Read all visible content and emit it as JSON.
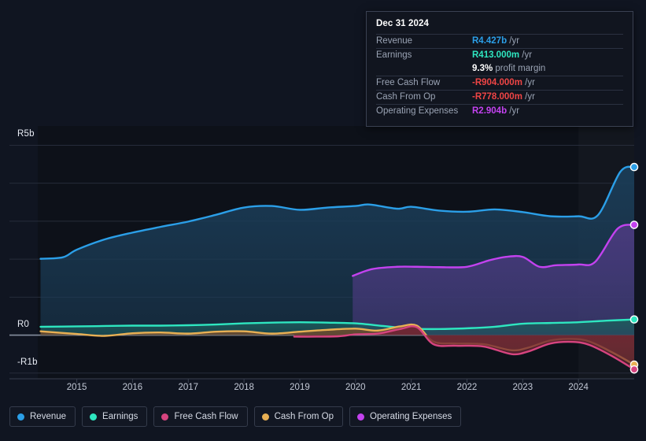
{
  "tooltip": {
    "date": "Dec 31 2024",
    "rows": [
      {
        "key": "Revenue",
        "amount": "R4.427b",
        "unit": "/yr",
        "color": "#2b9fe8"
      },
      {
        "key": "Earnings",
        "amount": "R413.000m",
        "unit": "/yr",
        "color": "#2ee6c0"
      },
      {
        "key": "",
        "amount": "9.3%",
        "unit": "profit margin",
        "color": "#ffffff"
      },
      {
        "key": "Free Cash Flow",
        "amount": "-R904.000m",
        "unit": "/yr",
        "color": "#ef4545"
      },
      {
        "key": "Cash From Op",
        "amount": "-R778.000m",
        "unit": "/yr",
        "color": "#ef4545"
      },
      {
        "key": "Operating Expenses",
        "amount": "R2.904b",
        "unit": "/yr",
        "color": "#c342ef"
      }
    ]
  },
  "legend": [
    {
      "label": "Revenue",
      "color": "#2b9fe8"
    },
    {
      "label": "Earnings",
      "color": "#2ee6c0"
    },
    {
      "label": "Free Cash Flow",
      "color": "#d6447f"
    },
    {
      "label": "Cash From Op",
      "color": "#e8b054"
    },
    {
      "label": "Operating Expenses",
      "color": "#c342ef"
    }
  ],
  "chart_data": {
    "type": "area",
    "title": "",
    "xlabel": "",
    "ylabel": "",
    "currency_prefix": "R",
    "grid": true,
    "legend_position": "bottom",
    "ylim": [
      -1.15,
      5.3
    ],
    "ytick_labels": [
      "R5b",
      "R0",
      "-R1b"
    ],
    "ytick_values": [
      5,
      0,
      -1
    ],
    "xtick_labels": [
      "2015",
      "2016",
      "2017",
      "2018",
      "2019",
      "2020",
      "2021",
      "2022",
      "2023",
      "2024"
    ],
    "xtick_values": [
      2015,
      2016,
      2017,
      2018,
      2019,
      2020,
      2021,
      2022,
      2023,
      2024
    ],
    "xlim": [
      2014.3,
      2025.0
    ],
    "highlight_band": {
      "from": 2024.0,
      "to": 2025.0
    },
    "units": "billions of ZAR per year",
    "series": [
      {
        "name": "Revenue",
        "color": "#2b9fe8",
        "fill": "#1b3d58",
        "x": [
          2014.35,
          2014.75,
          2015.0,
          2015.5,
          2016.0,
          2016.5,
          2017.0,
          2017.5,
          2018.0,
          2018.5,
          2019.0,
          2019.5,
          2020.0,
          2020.25,
          2020.75,
          2021.0,
          2021.5,
          2022.0,
          2022.5,
          2023.0,
          2023.5,
          2024.0,
          2024.35,
          2024.75,
          2025.0
        ],
        "y": [
          2.01,
          2.05,
          2.25,
          2.52,
          2.7,
          2.85,
          2.99,
          3.17,
          3.36,
          3.4,
          3.3,
          3.36,
          3.4,
          3.44,
          3.33,
          3.38,
          3.28,
          3.25,
          3.31,
          3.24,
          3.13,
          3.13,
          3.16,
          4.3,
          4.427
        ],
        "end_value": 4.427,
        "end_marker": true
      },
      {
        "name": "Operating Expenses",
        "color": "#c342ef",
        "fill": "#4a3a7e",
        "x": [
          2019.95,
          2020.3,
          2020.75,
          2021.1,
          2021.5,
          2022.0,
          2022.4,
          2022.7,
          2023.0,
          2023.3,
          2023.6,
          2024.0,
          2024.3,
          2024.7,
          2025.0
        ],
        "y": [
          1.56,
          1.74,
          1.8,
          1.8,
          1.79,
          1.8,
          1.97,
          2.06,
          2.06,
          1.8,
          1.84,
          1.86,
          1.93,
          2.8,
          2.904
        ],
        "end_value": 2.904,
        "end_marker": true,
        "starts_at": 2019.95
      },
      {
        "name": "Earnings",
        "color": "#2ee6c0",
        "fill": "#1d5b5c",
        "x": [
          2014.35,
          2015.0,
          2015.5,
          2016.0,
          2016.5,
          2017.0,
          2017.5,
          2018.0,
          2018.5,
          2019.0,
          2019.5,
          2020.0,
          2020.5,
          2021.0,
          2021.5,
          2022.0,
          2022.5,
          2023.0,
          2023.5,
          2024.0,
          2024.5,
          2025.0
        ],
        "y": [
          0.22,
          0.23,
          0.24,
          0.25,
          0.25,
          0.26,
          0.28,
          0.31,
          0.33,
          0.34,
          0.33,
          0.31,
          0.24,
          0.17,
          0.16,
          0.18,
          0.22,
          0.3,
          0.32,
          0.34,
          0.38,
          0.413
        ],
        "end_value": 0.413,
        "end_marker": true
      },
      {
        "name": "Cash From Op",
        "color": "#e8b054",
        "fill": "#6b4a2e",
        "x": [
          2014.35,
          2015.0,
          2015.5,
          2016.0,
          2016.5,
          2017.0,
          2017.5,
          2018.0,
          2018.5,
          2019.0,
          2019.5,
          2020.0,
          2020.4,
          2020.8,
          2021.1,
          2021.4,
          2021.8,
          2022.3,
          2022.8,
          2023.1,
          2023.5,
          2023.9,
          2024.2,
          2024.6,
          2025.0
        ],
        "y": [
          0.1,
          0.03,
          -0.02,
          0.05,
          0.07,
          0.04,
          0.09,
          0.1,
          0.04,
          0.09,
          0.14,
          0.17,
          0.12,
          0.23,
          0.25,
          -0.17,
          -0.22,
          -0.24,
          -0.4,
          -0.33,
          -0.14,
          -0.1,
          -0.17,
          -0.45,
          -0.778
        ],
        "end_value": -0.778,
        "end_marker": true
      },
      {
        "name": "Free Cash Flow",
        "color": "#d6447f",
        "fill": "#6e2434",
        "x": [
          2018.9,
          2019.3,
          2019.7,
          2020.0,
          2020.4,
          2020.8,
          2021.1,
          2021.4,
          2021.8,
          2022.3,
          2022.8,
          2023.1,
          2023.5,
          2023.9,
          2024.2,
          2024.6,
          2025.0
        ],
        "y": [
          -0.04,
          -0.04,
          -0.03,
          0.02,
          0.04,
          0.16,
          0.21,
          -0.24,
          -0.28,
          -0.3,
          -0.5,
          -0.43,
          -0.22,
          -0.18,
          -0.26,
          -0.55,
          -0.904
        ],
        "end_value": -0.904,
        "end_marker": true,
        "starts_at": 2018.9
      }
    ]
  }
}
